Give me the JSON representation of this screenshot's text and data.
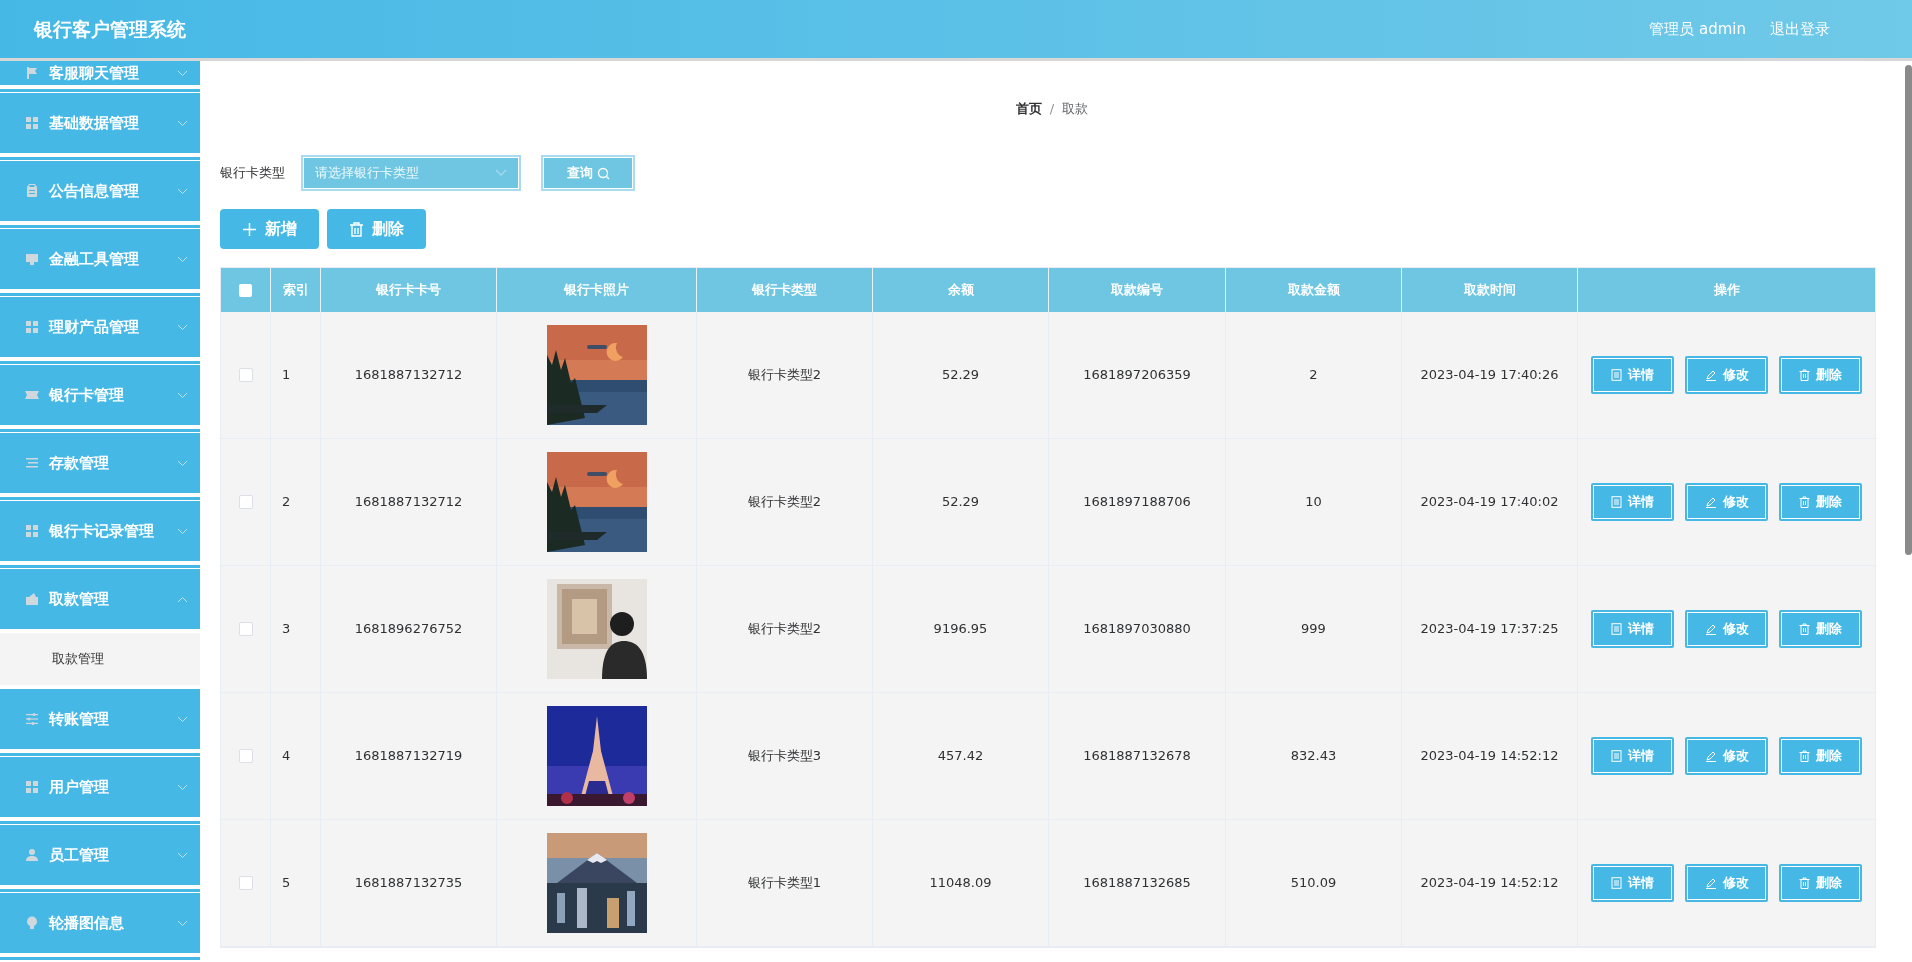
{
  "header": {
    "title": "银行客户管理系统",
    "user": "管理员 admin",
    "logout": "退出登录"
  },
  "sidebar": {
    "items": [
      {
        "label": "客服聊天管理",
        "expanded": false
      },
      {
        "label": "基础数据管理",
        "expanded": false
      },
      {
        "label": "公告信息管理",
        "expanded": false
      },
      {
        "label": "金融工具管理",
        "expanded": false
      },
      {
        "label": "理财产品管理",
        "expanded": false
      },
      {
        "label": "银行卡管理",
        "expanded": false
      },
      {
        "label": "存款管理",
        "expanded": false
      },
      {
        "label": "银行卡记录管理",
        "expanded": false
      },
      {
        "label": "取款管理",
        "expanded": true,
        "children": [
          {
            "label": "取款管理"
          }
        ]
      },
      {
        "label": "转账管理",
        "expanded": false
      },
      {
        "label": "用户管理",
        "expanded": false
      },
      {
        "label": "员工管理",
        "expanded": false
      },
      {
        "label": "轮播图信息",
        "expanded": false
      }
    ]
  },
  "breadcrumb": {
    "items": [
      "首页",
      "取款"
    ],
    "separator": "/"
  },
  "filter": {
    "label": "银行卡类型",
    "placeholder": "请选择银行卡类型",
    "search_button": "查询"
  },
  "actions": [
    {
      "kind": "add",
      "label": "新增"
    },
    {
      "kind": "delete",
      "label": "删除"
    }
  ],
  "table": {
    "select_all_checked": false,
    "columns": [
      "索引",
      "银行卡卡号",
      "银行卡照片",
      "银行卡类型",
      "余额",
      "取款编号",
      "取款金额",
      "取款时间",
      "操作"
    ],
    "rows": [
      {
        "checked": false,
        "index": "1",
        "card_no": "1681887132712",
        "card_type": "银行卡类型2",
        "balance": "52.29",
        "withdraw_no": "1681897206359",
        "amount": "2",
        "time": "2023-04-19 17:40:26",
        "buttons": [
          {
            "kind": "detail",
            "label": "详情"
          },
          {
            "kind": "edit",
            "label": "修改"
          },
          {
            "kind": "delete",
            "label": "删除"
          }
        ]
      },
      {
        "checked": false,
        "index": "2",
        "card_no": "1681887132712",
        "card_type": "银行卡类型2",
        "balance": "52.29",
        "withdraw_no": "1681897188706",
        "amount": "10",
        "time": "2023-04-19 17:40:02",
        "buttons": [
          {
            "kind": "detail",
            "label": "详情"
          },
          {
            "kind": "edit",
            "label": "修改"
          },
          {
            "kind": "delete",
            "label": "删除"
          }
        ]
      },
      {
        "checked": false,
        "index": "3",
        "card_no": "1681896276752",
        "card_type": "银行卡类型2",
        "balance": "9196.95",
        "withdraw_no": "1681897030880",
        "amount": "999",
        "time": "2023-04-19 17:37:25",
        "buttons": [
          {
            "kind": "detail",
            "label": "详情"
          },
          {
            "kind": "edit",
            "label": "修改"
          },
          {
            "kind": "delete",
            "label": "删除"
          }
        ]
      },
      {
        "checked": false,
        "index": "4",
        "card_no": "1681887132719",
        "card_type": "银行卡类型3",
        "balance": "457.42",
        "withdraw_no": "1681887132678",
        "amount": "832.43",
        "time": "2023-04-19 14:52:12",
        "buttons": [
          {
            "kind": "detail",
            "label": "详情"
          },
          {
            "kind": "edit",
            "label": "修改"
          },
          {
            "kind": "delete",
            "label": "删除"
          }
        ]
      },
      {
        "checked": false,
        "index": "5",
        "card_no": "1681887132735",
        "card_type": "银行卡类型1",
        "balance": "11048.09",
        "withdraw_no": "1681887132685",
        "amount": "510.09",
        "time": "2023-04-19 14:52:12",
        "buttons": [
          {
            "kind": "detail",
            "label": "详情"
          },
          {
            "kind": "edit",
            "label": "修改"
          },
          {
            "kind": "delete",
            "label": "删除"
          }
        ]
      }
    ]
  }
}
